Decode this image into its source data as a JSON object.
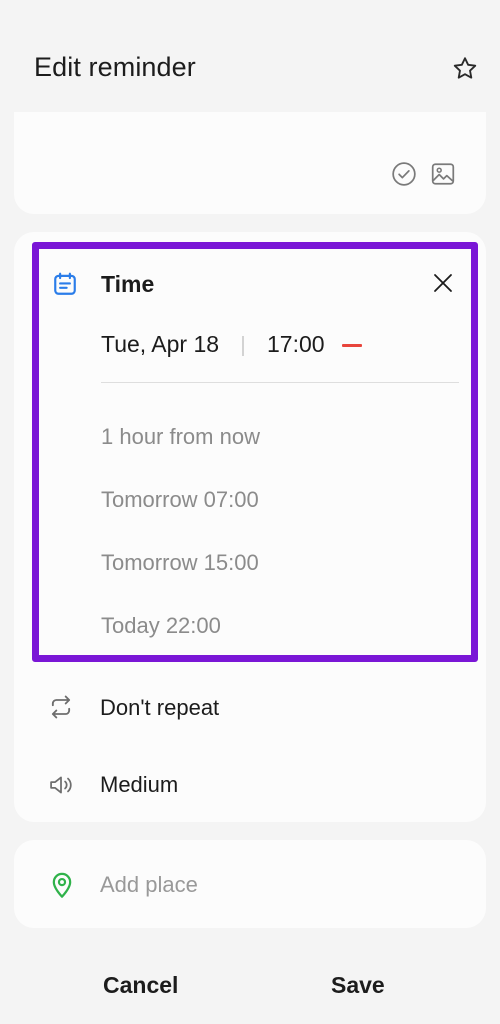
{
  "header": {
    "title": "Edit reminder",
    "star_icon": "star-outline-icon"
  },
  "content_card": {
    "check_icon": "check-circle-icon",
    "image_icon": "image-icon"
  },
  "time_section": {
    "label": "Time",
    "icon": "calendar-icon",
    "icon_color": "#2b7de9",
    "date": "Tue, Apr 18",
    "time": "17:00",
    "highlight_color": "#7a16d6",
    "options": [
      "1 hour from now",
      "Tomorrow 07:00",
      "Tomorrow 15:00",
      "Today 22:00"
    ]
  },
  "repeat": {
    "label": "Don't repeat",
    "icon": "repeat-icon"
  },
  "priority": {
    "label": "Medium",
    "icon": "sound-icon"
  },
  "place": {
    "placeholder": "Add place",
    "icon": "location-pin-icon",
    "icon_color": "#2fb24a"
  },
  "actions": {
    "cancel": "Cancel",
    "save": "Save"
  }
}
